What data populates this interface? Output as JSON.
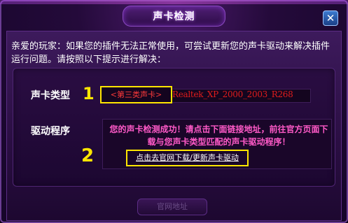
{
  "dialog": {
    "title": "声卡检测",
    "close_icon": "close-icon"
  },
  "intro": {
    "text": "亲爱的玩家：如果您的插件无法正常使用，可尝试更新您的声卡驱动来解决插件运行问题。请按照以下提示进行解决："
  },
  "sound_card": {
    "type_label": "声卡类型",
    "type_value": "<第三类声卡>",
    "driver_name": "Realtek_XP_2000_2003_R268"
  },
  "driver": {
    "label": "驱动程序",
    "message": "您的声卡检测成功！请点击下面链接地址，前往官方页面下载与您声卡类型匹配的声卡驱动程序！",
    "link_text": "点击去官网下载/更新声卡驱动"
  },
  "annotations": {
    "marker_1": "1",
    "marker_2": "2"
  },
  "footer": {
    "faded_button": "官网地址"
  },
  "colors": {
    "highlight_box": "#ffe600",
    "driver_text": "#e01c1c",
    "message_text": "#ff5ac8"
  }
}
